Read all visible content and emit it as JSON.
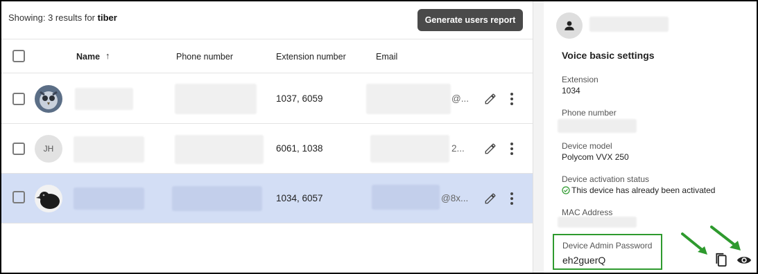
{
  "results": {
    "prefix": "Showing: 3 results for ",
    "query": "tiber"
  },
  "report_button": "Generate users report",
  "columns": {
    "name": "Name",
    "sort_indicator": "↑",
    "phone": "Phone number",
    "extension": "Extension number",
    "email": "Email"
  },
  "rows": [
    {
      "avatar": "owl-photo",
      "extensions": "1037, 6059",
      "email_tail": "@...",
      "selected": false
    },
    {
      "avatar_initials": "JH",
      "extensions": "6061, 1038",
      "email_tail": "2...",
      "selected": false
    },
    {
      "avatar": "bird-photo",
      "extensions": "1034, 6057",
      "email_tail": "@8x...",
      "selected": true
    }
  ],
  "details": {
    "title": "Voice basic settings",
    "extension_label": "Extension",
    "extension_value": "1034",
    "phone_label": "Phone number",
    "device_model_label": "Device model",
    "device_model_value": "Polycom VVX 250",
    "activation_label": "Device activation status",
    "activation_value": "This device has already been activated",
    "mac_label": "MAC Address",
    "password_label": "Device Admin Password",
    "password_value": "eh2guerQ"
  },
  "icons": {
    "sort": "arrow-up-icon",
    "edit": "pencil-icon",
    "more": "more-vertical-icon",
    "user": "person-icon",
    "status": "check-circle-icon",
    "copy": "copy-icon",
    "reveal": "eye-icon"
  },
  "colors": {
    "selected_row": "#d3def5",
    "button_bg": "#4a4a4a",
    "highlight": "#2e9a2e",
    "status_ok": "#2e9a2e"
  }
}
